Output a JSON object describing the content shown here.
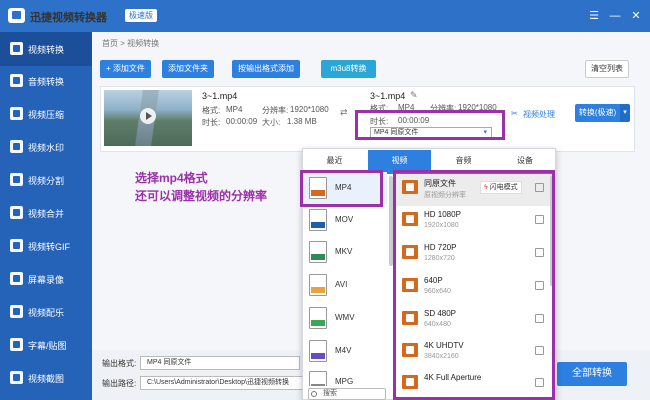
{
  "window": {
    "title": "迅捷视频转换器",
    "badge": "极速版",
    "controls": [
      "☰",
      "—",
      "✕"
    ]
  },
  "sidebar": {
    "items": [
      {
        "label": "视频转换",
        "active": true
      },
      {
        "label": "音频转换"
      },
      {
        "label": "视频压缩"
      },
      {
        "label": "视频水印"
      },
      {
        "label": "视频分割"
      },
      {
        "label": "视频合并"
      },
      {
        "label": "视频转GIF"
      },
      {
        "label": "屏幕录像"
      },
      {
        "label": "视频配乐"
      },
      {
        "label": "字幕/贴图"
      },
      {
        "label": "视频截图"
      }
    ]
  },
  "breadcrumb": "首页 > 视频转换",
  "toolbar": {
    "add_file": "+ 添加文件",
    "add_folder": "添加文件夹",
    "add_by_format": "按输出格式添加",
    "m3u8": "m3u8转换",
    "clear_list": "清空列表"
  },
  "file": {
    "name": "3~1.mp4",
    "format_label": "格式:",
    "format_value": "MP4",
    "resolution_label": "分辨率:",
    "resolution_value": "1920*1080",
    "duration_label": "时长:",
    "duration_value": "00:00:09",
    "size_label": "大小:",
    "size_value": "1.38 MB",
    "output_name": "3~1.mp4",
    "output_format_label": "格式:",
    "output_format_value": "MP4",
    "output_resolution_label": "分辨率:",
    "output_resolution_value": "1920*1080",
    "output_duration_label": "时长:",
    "output_duration_value": "00:00:09",
    "format_select": "MP4  同原文件",
    "process_label": "视频处理",
    "convert_button": "转换(极速)"
  },
  "annotation": {
    "line1": "选择mp4格式",
    "line2": "还可以调整视频的分辨率"
  },
  "popup": {
    "tabs": [
      "最近",
      "视频",
      "音频",
      "设备"
    ],
    "active_tab": "视频",
    "formats": [
      {
        "label": "MP4",
        "color": "#d2691e",
        "selected": true
      },
      {
        "label": "MOV",
        "color": "#1f5fa8"
      },
      {
        "label": "MKV",
        "color": "#2e8b57"
      },
      {
        "label": "AVI",
        "color": "#e8a33d"
      },
      {
        "label": "WMV",
        "color": "#3aa757"
      },
      {
        "label": "M4V",
        "color": "#6a4bc4"
      },
      {
        "label": "MPG",
        "color": "#888888"
      }
    ],
    "resolutions": [
      {
        "name": "同原文件",
        "detail": "原视频分辨率",
        "selected": true
      },
      {
        "name": "HD 1080P",
        "detail": "1920x1080"
      },
      {
        "name": "HD 720P",
        "detail": "1280x720"
      },
      {
        "name": "640P",
        "detail": "960x640"
      },
      {
        "name": "SD 480P",
        "detail": "640x480"
      },
      {
        "name": "4K UHDTV",
        "detail": "3840x2160"
      },
      {
        "name": "4K Full Aperture",
        "detail": ""
      }
    ],
    "flash_mode": "闪电模式",
    "search_placeholder": "搜索"
  },
  "bottom": {
    "output_format_label": "输出格式:",
    "output_format_value": "MP4  同原文件",
    "output_path_label": "输出路径:",
    "output_path_value": "C:\\Users\\Administrator\\Desktop\\迅捷视频转换",
    "convert_all": "全部转换"
  }
}
